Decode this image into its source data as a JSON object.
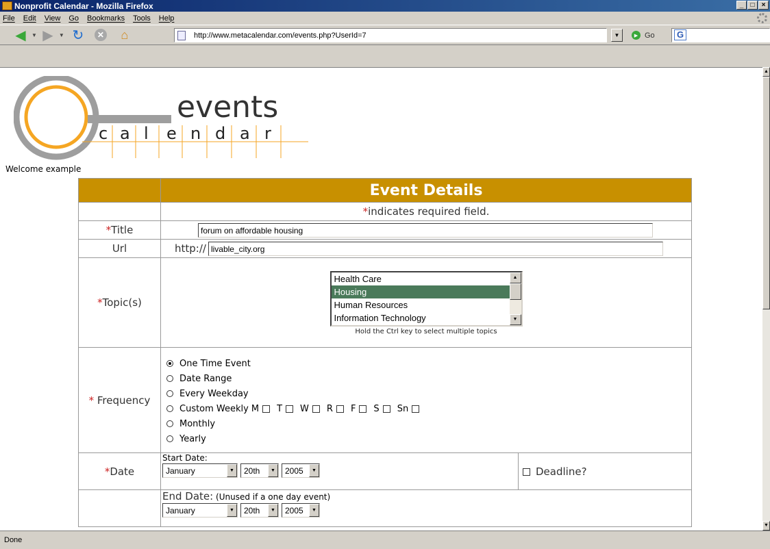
{
  "window": {
    "title": "Nonprofit Calendar - Mozilla Firefox",
    "controls": [
      "_",
      "□",
      "×"
    ]
  },
  "menu": [
    "File",
    "Edit",
    "View",
    "Go",
    "Bookmarks",
    "Tools",
    "Help"
  ],
  "toolbar": {
    "url": "http://www.metacalendar.com/events.php?UserId=7",
    "go_label": "Go",
    "search_icon_label": "G"
  },
  "logo": {
    "word_events": "events",
    "word_calendar": [
      "c",
      "a",
      "l",
      "e",
      "n",
      "d",
      "a",
      "r"
    ],
    "colors": {
      "orange": "#f5a623",
      "gray": "#9e9e9e"
    }
  },
  "page": {
    "welcome": "Welcome example",
    "header_title": "Event Details",
    "required_marker": "*",
    "required_note": "indicates required field.",
    "title_label": "Title",
    "title_value": "forum on affordable housing",
    "url_label": "Url",
    "url_prefix": "http://",
    "url_value": "livable_city.org",
    "topic_label": "Topic(s)",
    "topics": [
      {
        "label": "Health Care",
        "selected": false
      },
      {
        "label": "Housing",
        "selected": true
      },
      {
        "label": "Human Resources",
        "selected": false
      },
      {
        "label": "Information Technology",
        "selected": false
      }
    ],
    "topic_hint": "Hold the Ctrl key to select multiple topics",
    "frequency_label": "Frequency",
    "frequency_options": {
      "one_time": "One Time Event",
      "date_range": "Date Range",
      "every_weekday": "Every Weekday",
      "custom_weekly": "Custom Weekly",
      "monthly": "Monthly",
      "yearly": "Yearly"
    },
    "frequency_selected": "One Time Event",
    "weekdays": [
      "M",
      "T",
      "W",
      "R",
      "F",
      "S",
      "Sn"
    ],
    "date_label": "Date",
    "start_date_label": "Start Date:",
    "start_month": "January",
    "start_day": "20th",
    "start_year": "2005",
    "deadline_label": "Deadline?",
    "end_date_label": "End Date:",
    "end_date_note": "(Unused if a one day event)",
    "end_month": "January",
    "end_day": "20th",
    "end_year": "2005"
  },
  "status": "Done",
  "colors": {
    "header_bg": "#c89000",
    "required": "#cc2222",
    "selected_topic": "#4a7a5a"
  }
}
